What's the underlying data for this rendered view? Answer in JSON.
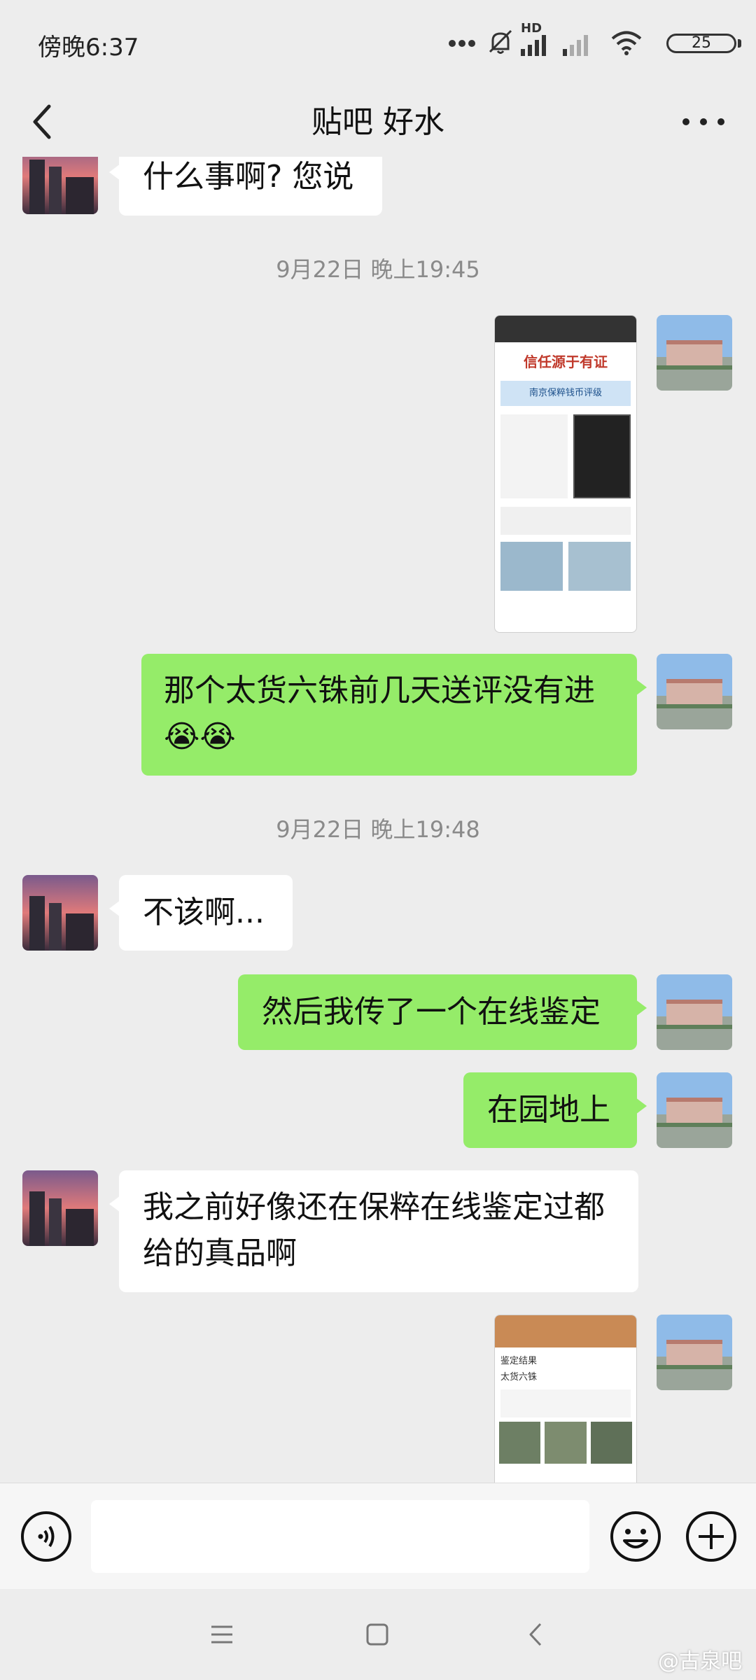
{
  "status_bar": {
    "time": "傍晚6:37",
    "battery": "25",
    "hd_label": "HD"
  },
  "header": {
    "title": "贴吧 好水"
  },
  "messages": [
    {
      "side": "in",
      "text": "什么事啊? 您说"
    },
    {
      "type": "timestamp",
      "text": "9月22日 晚上19:45"
    },
    {
      "side": "out",
      "type": "image",
      "caption": "信任源于有证",
      "subtitle": "南京保粹钱币评级"
    },
    {
      "side": "out",
      "text": "那个太货六铢前几天送评没有进😭😭"
    },
    {
      "type": "timestamp",
      "text": "9月22日 晚上19:48"
    },
    {
      "side": "in",
      "text": "不该啊..."
    },
    {
      "side": "out",
      "text": "然后我传了一个在线鉴定"
    },
    {
      "side": "out",
      "text": "在园地上"
    },
    {
      "side": "in",
      "text": "我之前好像还在保粹在线鉴定过都给的真品啊"
    },
    {
      "side": "out",
      "type": "image",
      "caption": "鉴定结果",
      "subtitle": "太货六铢"
    }
  ],
  "input": {
    "placeholder": ""
  },
  "watermark": "@古泉吧",
  "colors": {
    "outgoing_bubble": "#95ec69",
    "incoming_bubble": "#ffffff",
    "background": "#ededed"
  }
}
